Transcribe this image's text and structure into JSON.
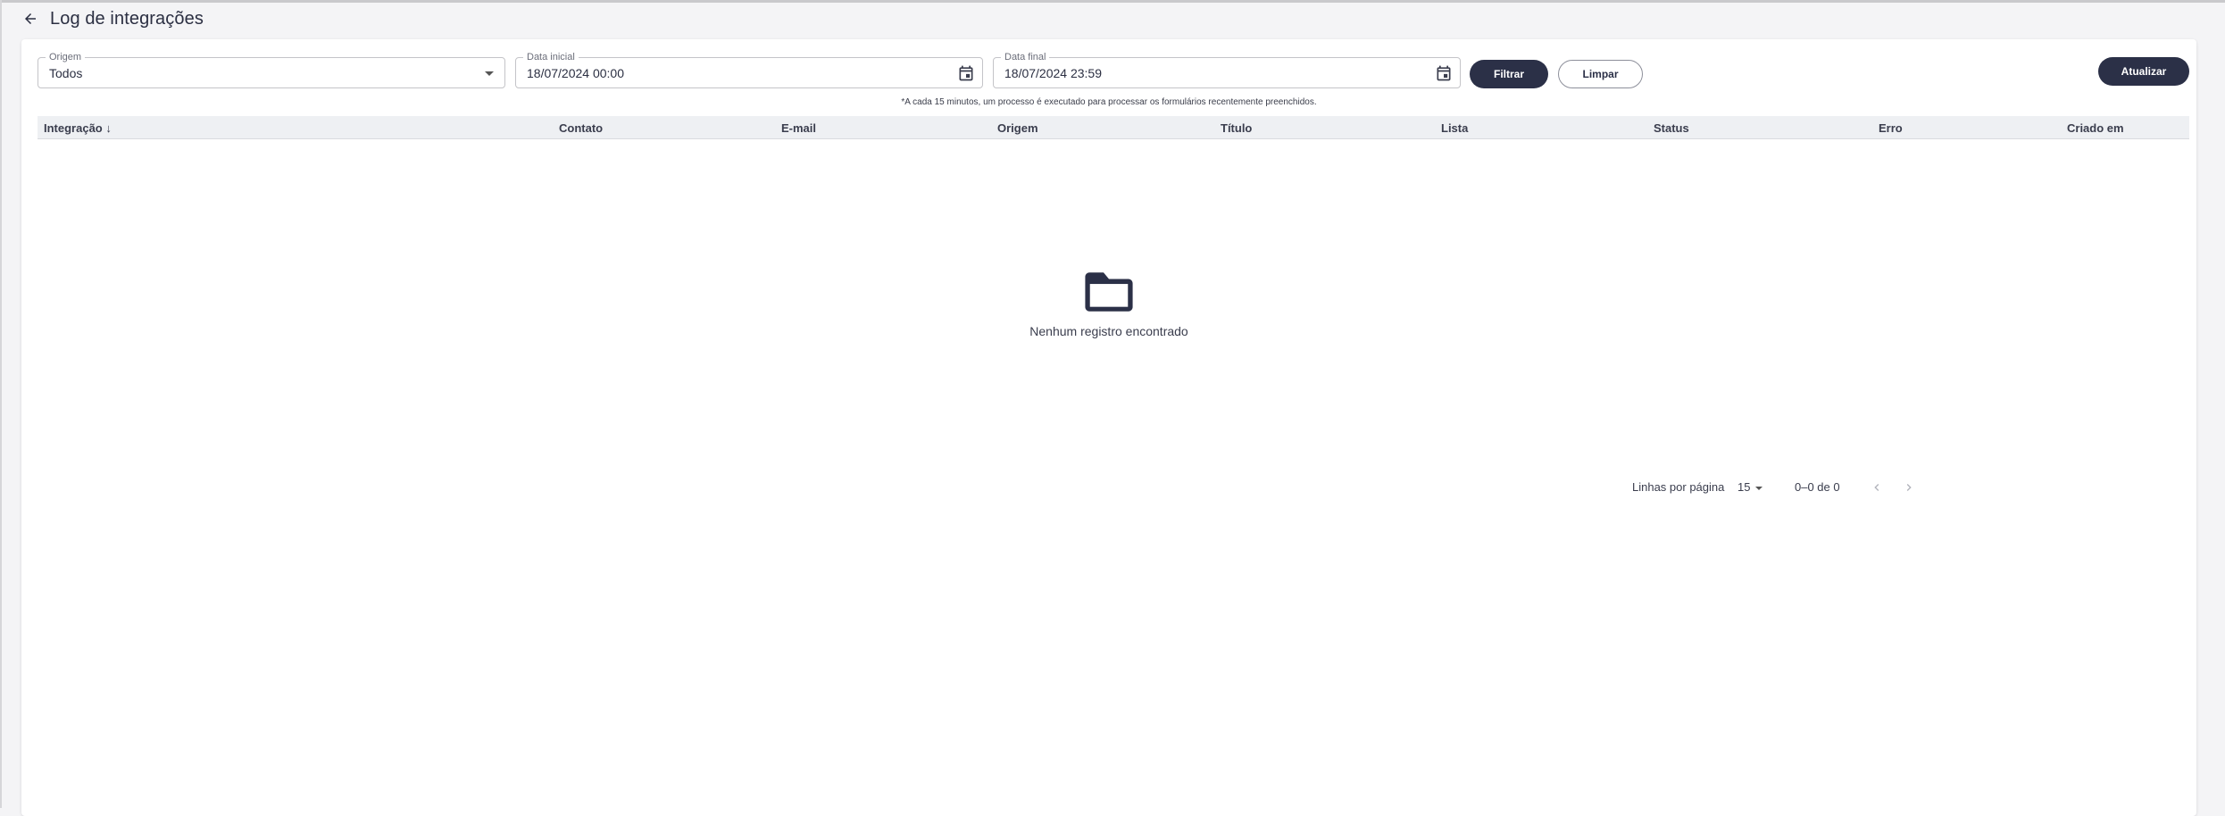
{
  "header": {
    "back_icon": "arrow-left-icon",
    "title": "Log de integrações"
  },
  "filters": {
    "origem": {
      "label": "Origem",
      "value": "Todos"
    },
    "data_inicial": {
      "label": "Data inicial",
      "value": "18/07/2024 00:00",
      "icon": "calendar-icon"
    },
    "data_final": {
      "label": "Data final",
      "value": "18/07/2024 23:59",
      "icon": "calendar-icon"
    },
    "filtrar_label": "Filtrar",
    "limpar_label": "Limpar",
    "atualizar_label": "Atualizar"
  },
  "note": "*A cada 15 minutos, um processo é executado para processar os formulários recentemente preenchidos.",
  "table": {
    "columns": [
      "Integração",
      "Contato",
      "E-mail",
      "Origem",
      "Título",
      "Lista",
      "Status",
      "Erro",
      "Criado em"
    ],
    "sort_indicator": "↓",
    "rows": []
  },
  "empty_state": {
    "icon": "folder-icon",
    "text": "Nenhum registro encontrado"
  },
  "pagination": {
    "rows_per_page_label": "Linhas por página",
    "rows_per_page": "15",
    "range": "0–0 de 0"
  },
  "colors": {
    "primary": "#2b3047",
    "header_bg": "#eef0f3",
    "page_bg": "#f4f4f6"
  }
}
